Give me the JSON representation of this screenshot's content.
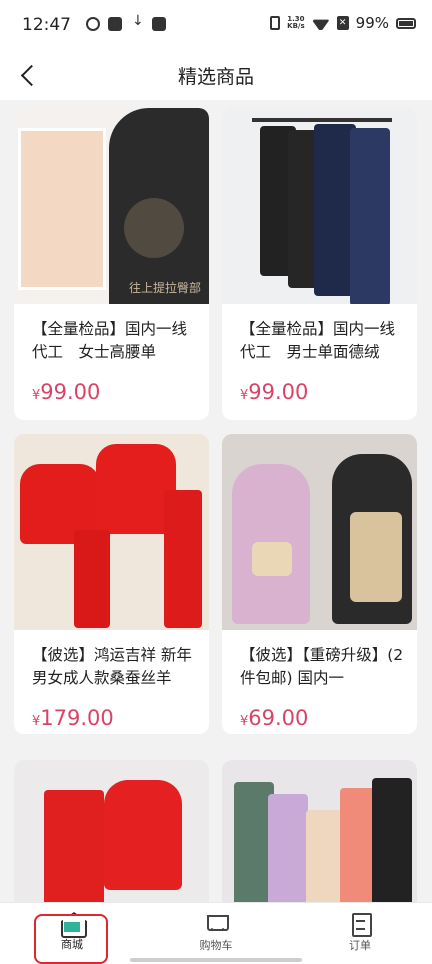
{
  "status_bar": {
    "time": "12:47",
    "net_speed_value": "1.30",
    "net_speed_unit": "KB/s",
    "battery": "99%"
  },
  "header": {
    "title": "精选商品",
    "back_icon": "chevron-left-icon"
  },
  "products": [
    {
      "name": "【全量检品】国内一线代工　女士高腰单",
      "currency": "¥",
      "price": "99.00",
      "overlay": "往上提拉臀部"
    },
    {
      "name": "【全量检品】国内一线代工　男士单面德绒",
      "currency": "¥",
      "price": "99.00"
    },
    {
      "name": "【彼选】鸿运吉祥 新年男女成人款桑蚕丝羊",
      "currency": "¥",
      "price": "179.00"
    },
    {
      "name": "【彼选】【重磅升级】(2件包邮) 国内一",
      "currency": "¥",
      "price": "69.00"
    },
    {
      "name": "",
      "currency": "",
      "price": ""
    },
    {
      "name": "",
      "currency": "",
      "price": ""
    }
  ],
  "tabbar": {
    "tabs": [
      {
        "label": "商城",
        "icon": "home-icon",
        "active": true
      },
      {
        "label": "购物车",
        "icon": "cart-icon",
        "active": false
      },
      {
        "label": "订单",
        "icon": "order-icon",
        "active": false
      }
    ]
  },
  "colors": {
    "price": "#d84468",
    "accent": "#2fb39b",
    "highlight_box": "#e0272d"
  }
}
